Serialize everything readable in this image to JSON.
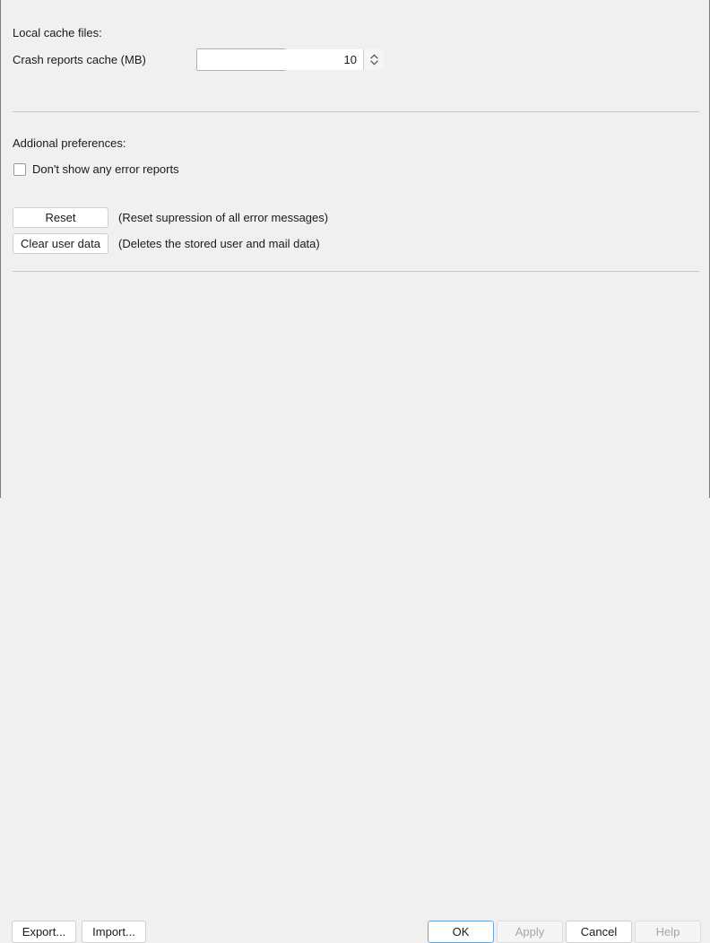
{
  "sections": {
    "cache": {
      "heading": "Local cache files:",
      "crash_cache_label": "Crash reports cache (MB)",
      "crash_cache_value": "10",
      "crash_cache_placeholder": "10"
    },
    "additional": {
      "heading": "Addional preferences:",
      "no_error_reports_label": "Don't show any error reports",
      "no_error_reports_checked": false,
      "actions": [
        {
          "button_label": "Reset",
          "description": "(Reset supression of all error messages)"
        },
        {
          "button_label": "Clear user data",
          "description": "(Deletes the stored user and mail data)"
        }
      ]
    }
  },
  "footer": {
    "export_label": "Export...",
    "import_label": "Import...",
    "ok_label": "OK",
    "apply_label": "Apply",
    "cancel_label": "Cancel",
    "help_label": "Help"
  },
  "icons": {
    "spinner": "spinner-up-down-icon"
  },
  "colors": {
    "background": "#f0f0f0",
    "text": "#1a1a1a",
    "separator": "#c8c6c4",
    "button_border": "#d0cece",
    "focus_ring": "#6aa8e0",
    "disabled_text": "#a6a6a6",
    "field_border": "#b3b0ad"
  }
}
